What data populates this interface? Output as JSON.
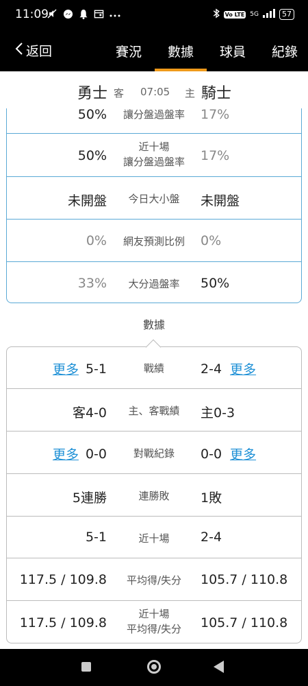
{
  "status": {
    "time": "11:09",
    "left_icons": [
      "mute-icon",
      "messenger-icon",
      "bell-icon",
      "calendar-icon",
      "more-dots-icon"
    ],
    "network": "5G",
    "volte": "Vo LTE",
    "battery": "57"
  },
  "nav": {
    "back_label": "返回",
    "tabs": [
      {
        "label": "賽況",
        "active": false
      },
      {
        "label": "數據",
        "active": true
      },
      {
        "label": "球員",
        "active": false
      },
      {
        "label": "紀錄",
        "active": false
      }
    ],
    "accent": "#ef9a1b"
  },
  "match": {
    "away_team": "勇士",
    "away_label": "客",
    "time": "07:05",
    "home_label": "主",
    "home_team": "騎士"
  },
  "odds_rows": [
    {
      "away": "50%",
      "label": "讓分盤過盤率",
      "home": "17%"
    },
    {
      "away": "50%",
      "label_line1": "近十場",
      "label_line2": "讓分盤過盤率",
      "home": "17%"
    },
    {
      "away": "未開盤",
      "label": "今日大小盤",
      "home": "未開盤"
    },
    {
      "away": "0%",
      "label": "網友預測比例",
      "home": "0%"
    },
    {
      "away": "33%",
      "label": "大分過盤率",
      "home": "50%"
    }
  ],
  "section_title": "數據",
  "more_label": "更多",
  "stats_rows": [
    {
      "away": "5-1",
      "label": "戰績",
      "home": "2-4",
      "has_more": true
    },
    {
      "away": "客4-0",
      "label": "主、客戰績",
      "home": "主0-3",
      "has_more": false
    },
    {
      "away": "0-0",
      "label": "對戰紀錄",
      "home": "0-0",
      "has_more": true
    },
    {
      "away": "5連勝",
      "label": "連勝敗",
      "home": "1敗",
      "has_more": false
    },
    {
      "away": "5-1",
      "label": "近十場",
      "home": "2-4",
      "has_more": false
    },
    {
      "away": "117.5 / 109.8",
      "label": "平均得/失分",
      "home": "105.7 / 110.8",
      "has_more": false
    },
    {
      "away": "117.5 / 109.8",
      "label_line1": "近十場",
      "label_line2": "平均得/失分",
      "home": "105.7 / 110.8",
      "has_more": false
    }
  ]
}
